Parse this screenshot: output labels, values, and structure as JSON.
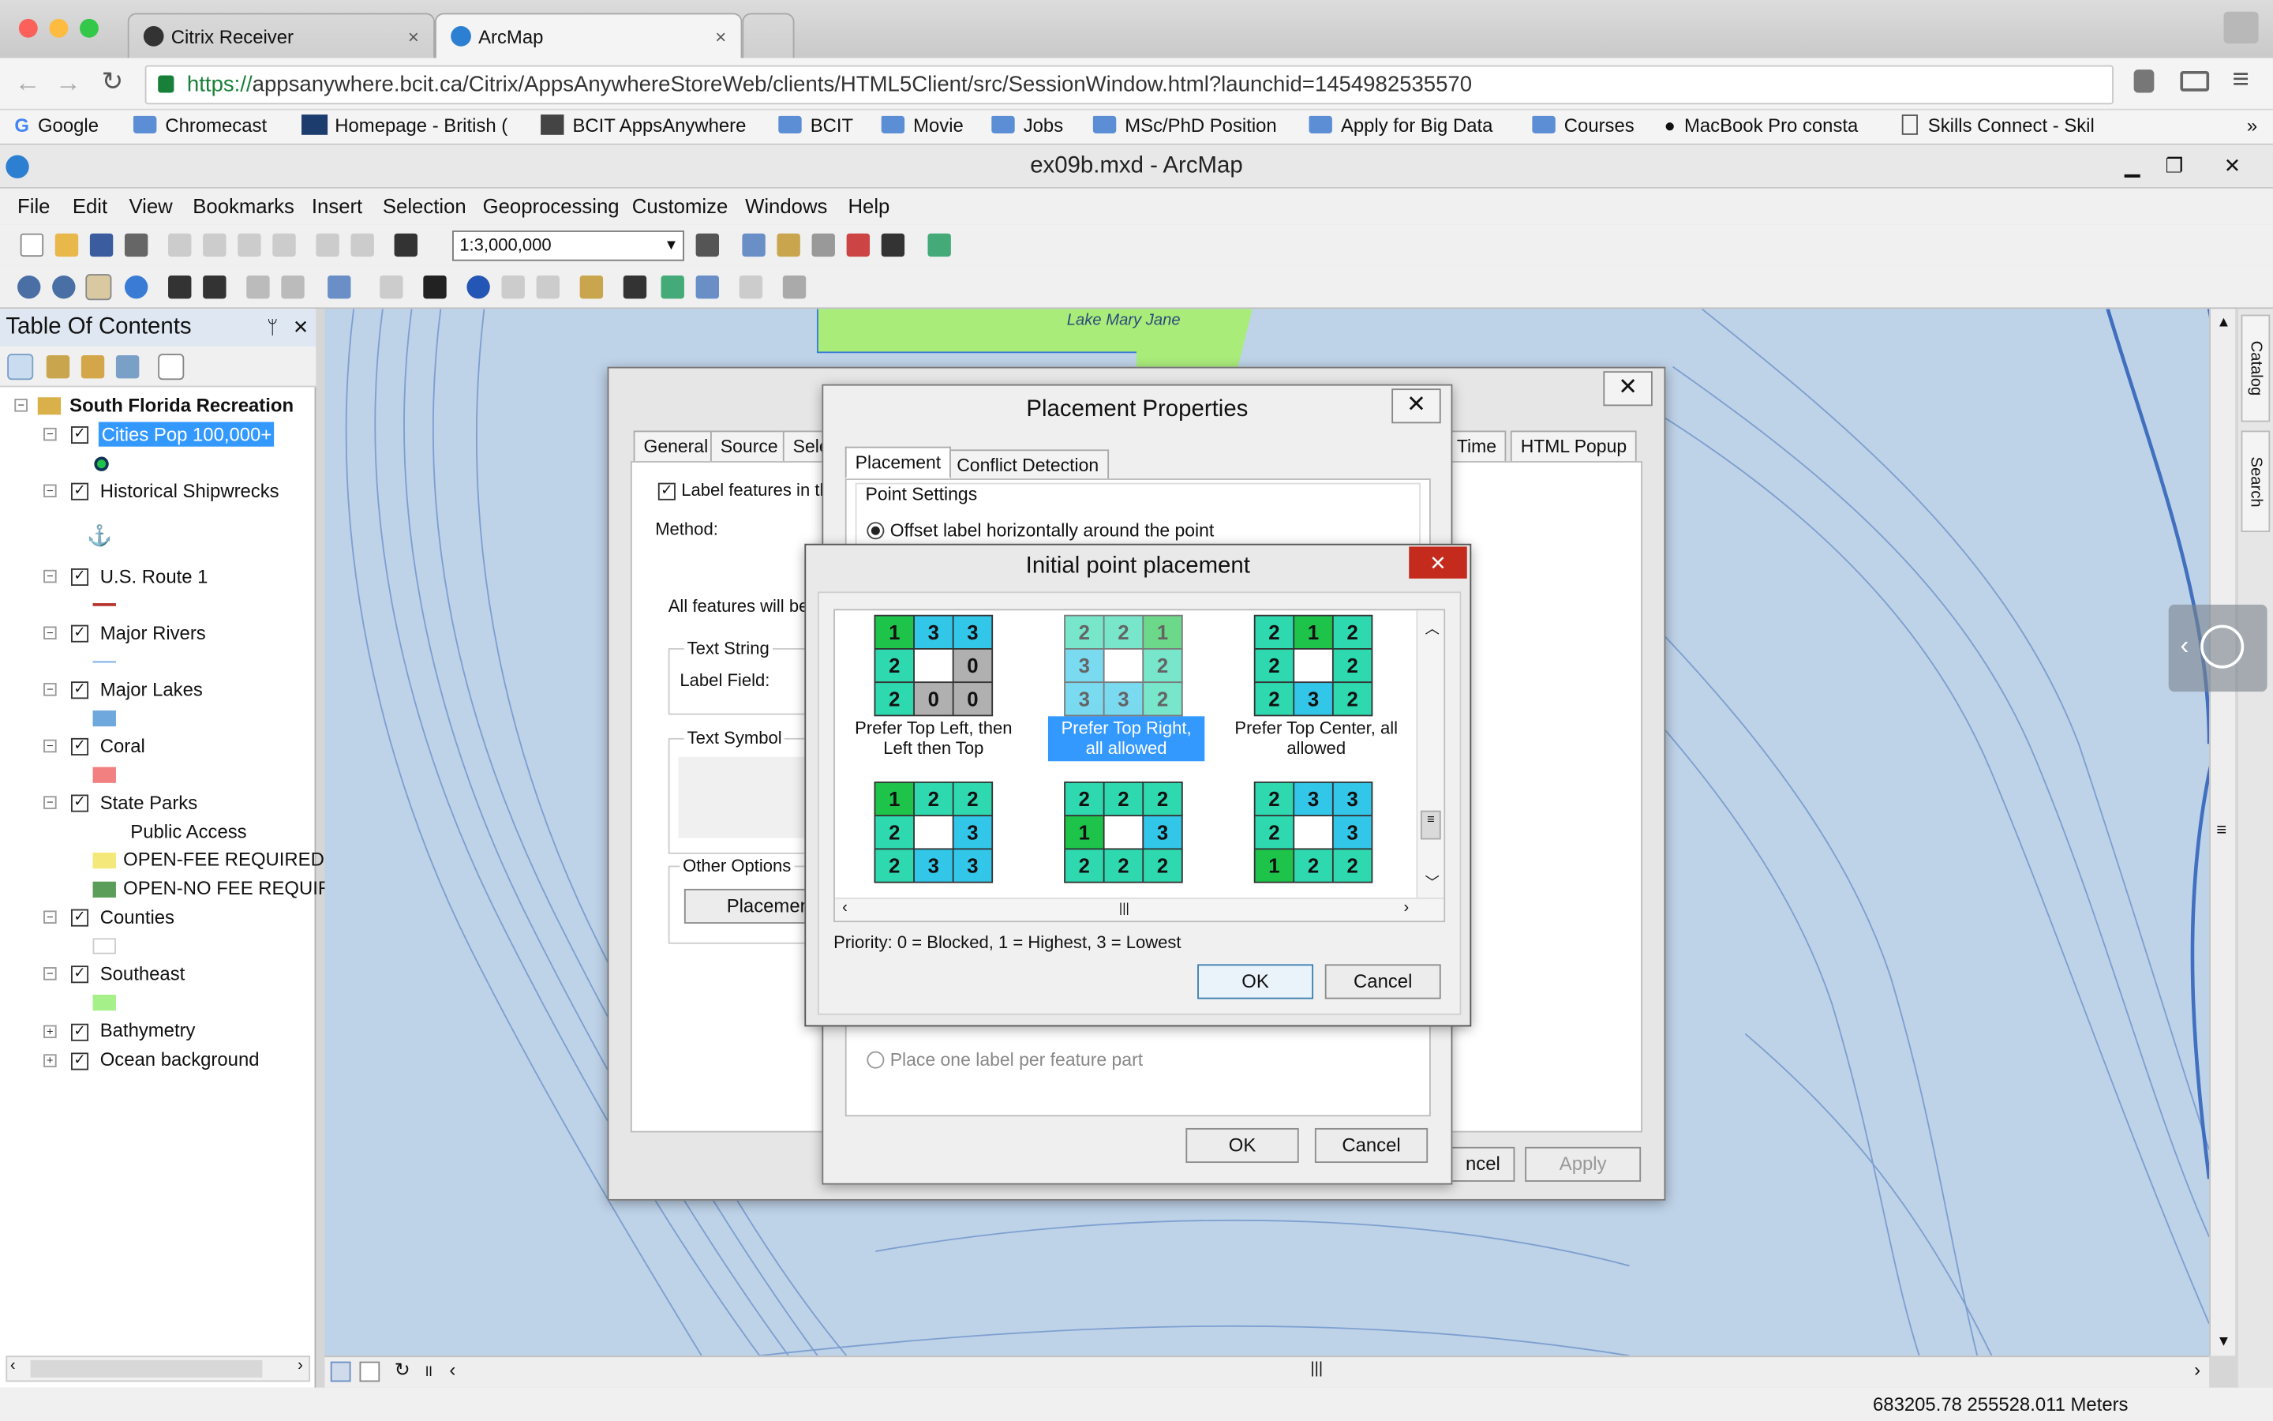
{
  "browser": {
    "tabs": [
      {
        "title": "Citrix Receiver",
        "close": "×"
      },
      {
        "title": "ArcMap",
        "close": "×"
      }
    ],
    "url_scheme": "https://",
    "url_rest": "appsanywhere.bcit.ca/Citrix/AppsAnywhereStoreWeb/clients/HTML5Client/src/SessionWindow.html?launchid=1454982535570",
    "bookmarks": [
      "Google",
      "Chromecast",
      "Homepage - British (",
      "BCIT AppsAnywhere",
      "BCIT",
      "Movie",
      "Jobs",
      "MSc/PhD Position",
      "Apply for Big Data",
      "Courses",
      "MacBook Pro consta",
      "Skills Connect - Skil"
    ],
    "more": "»"
  },
  "arcmap": {
    "title": "ex09b.mxd - ArcMap",
    "menus": [
      "File",
      "Edit",
      "View",
      "Bookmarks",
      "Insert",
      "Selection",
      "Geoprocessing",
      "Customize",
      "Windows",
      "Help"
    ],
    "scale": "1:3,000,000"
  },
  "toc": {
    "title": "Table Of Contents",
    "pin": "ᛘ",
    "close": "✕",
    "root": "South Florida Recreation",
    "layers": [
      "Cities Pop 100,000+",
      "Historical Shipwrecks",
      "U.S. Route 1",
      "Major Rivers",
      "Major Lakes",
      "Coral",
      "State Parks",
      "Counties",
      "Southeast",
      "Bathymetry",
      "Ocean background"
    ],
    "state_parks_sub": {
      "heading": "Public Access",
      "items": [
        "OPEN-FEE REQUIRED",
        "OPEN-NO FEE REQUIR"
      ]
    }
  },
  "map": {
    "label": "Lake Mary Jane",
    "right_tabs": [
      "Catalog",
      "Search"
    ]
  },
  "status": {
    "coords": "683205.78  255528.011 Meters"
  },
  "layer_props": {
    "tabs": [
      "General",
      "Source",
      "Sele",
      "Time",
      "HTML Popup"
    ],
    "label_features": "Label features in th",
    "method": "Method:",
    "all_features": "All features will be",
    "text_string": "Text String",
    "label_field": "Label Field:",
    "text_symbol": "Text Symbol",
    "other_options": "Other Options",
    "placement_btn": "Placement",
    "cancel_partial": "ncel",
    "apply": "Apply"
  },
  "placement_props": {
    "title": "Placement Properties",
    "tabs": [
      "Placement",
      "Conflict Detection"
    ],
    "point_settings": "Point Settings",
    "offset_radio": "Offset label horizontally around the point",
    "one_per_part": "Place one label per feature part",
    "ok": "OK",
    "cancel": "Cancel"
  },
  "initial_placement": {
    "title": "Initial point placement",
    "close": "✕",
    "options": [
      {
        "caption": "Prefer Top Left, then Left then Top",
        "grid": [
          "1",
          "3",
          "3",
          "2",
          "",
          "0",
          "2",
          "0",
          "0"
        ],
        "selected": false
      },
      {
        "caption": "Prefer Top Right, all allowed",
        "grid": [
          "2",
          "2",
          "1",
          "3",
          "",
          "2",
          "3",
          "3",
          "2"
        ],
        "selected": true
      },
      {
        "caption": "Prefer Top Center, all allowed",
        "grid": [
          "2",
          "1",
          "2",
          "2",
          "",
          "2",
          "2",
          "3",
          "2"
        ],
        "selected": false
      },
      {
        "caption": "",
        "grid": [
          "1",
          "2",
          "2",
          "2",
          "",
          "3",
          "2",
          "3",
          "3"
        ],
        "selected": false
      },
      {
        "caption": "",
        "grid": [
          "2",
          "2",
          "2",
          "1",
          "",
          "3",
          "2",
          "2",
          "2"
        ],
        "selected": false
      },
      {
        "caption": "",
        "grid": [
          "2",
          "3",
          "3",
          "2",
          "",
          "3",
          "1",
          "2",
          "2"
        ],
        "selected": false
      }
    ],
    "priority_legend": "Priority:  0 = Blocked, 1 = Highest, 3 = Lowest",
    "ok": "OK",
    "cancel": "Cancel"
  },
  "colors": {
    "highest": "#1ec34a",
    "mid": "#2fd9b0",
    "lowest": "#32c6e8",
    "blocked": "#b0b0b0",
    "selection": "#3399ff",
    "close_red": "#c42b1c"
  }
}
